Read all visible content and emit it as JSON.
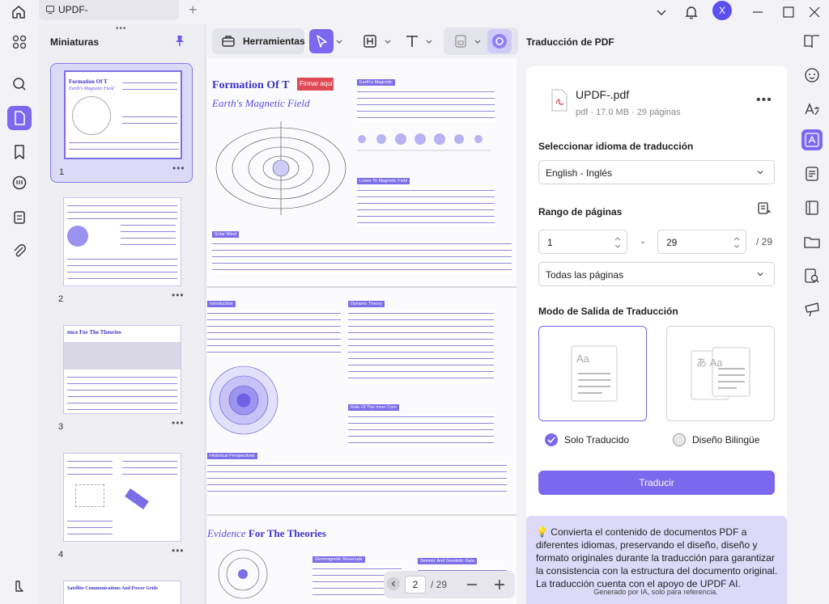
{
  "titlebar": {
    "tab_label": "UPDF-",
    "avatar_initial": "X",
    "new_tab_symbol": "+"
  },
  "thumbnails": {
    "title": "Miniaturas",
    "pages": [
      {
        "number": "1",
        "heading": "Formation Of T"
      },
      {
        "number": "2"
      },
      {
        "number": "3",
        "heading": "ence For The Theories"
      },
      {
        "number": "4"
      },
      {
        "number": "",
        "heading": "Satellite Communications And Power Grids"
      }
    ],
    "more_symbol": "•••"
  },
  "toolbar": {
    "tools_label": "Herramientas"
  },
  "document": {
    "title": "Formation Of T",
    "subtitle": "Earth's Magnetic Field",
    "annotation": "Firmar aquí",
    "tags": [
      "Earth's Magnetic",
      "Loses To Magnetic Field",
      "Solar Wind",
      "Introduction",
      "Dynamo Theory",
      "Role Of The Inner Core",
      "Historical Perspectives",
      "Geomagnetic Reversals",
      "Seismic And Geodetic Data"
    ],
    "section_title_a": "Evidence",
    "section_title_b": " For The Theories",
    "page_current": "2",
    "page_total": "/ 29"
  },
  "panel": {
    "title": "Traducción de PDF",
    "file_name": "UPDF-.pdf",
    "file_meta": "pdf · 17.0 MB · 29 páginas",
    "language_label": "Seleccionar idioma de traducción",
    "language_value": "English - Inglés",
    "range_label": "Rango de páginas",
    "range_from": "1",
    "range_dash": "-",
    "range_to": "29",
    "range_total": "/ 29",
    "pages_option": "Todas las páginas",
    "mode_label": "Modo de Salida de Traducción",
    "mode_only": "Solo Traducido",
    "mode_bilingual": "Diseño Bilingüe",
    "mode_only_icon_text": "Aa",
    "mode_bilingual_icon_text": "あ Aa",
    "translate_button": "Traducir",
    "info": "Convierta el contenido de documentos PDF a diferentes idiomas, preservando el diseño, diseño y formato originales durante la traducción para garantizar la consistencia con la estructura del documento original. La traducción cuenta con el apoyo de UPDF AI.",
    "footer": "Generado por IA, solo para referencia."
  },
  "colors": {
    "accent": "#7b68ee",
    "doc_heading": "#3d33c9",
    "annotation": "#e04a55"
  }
}
